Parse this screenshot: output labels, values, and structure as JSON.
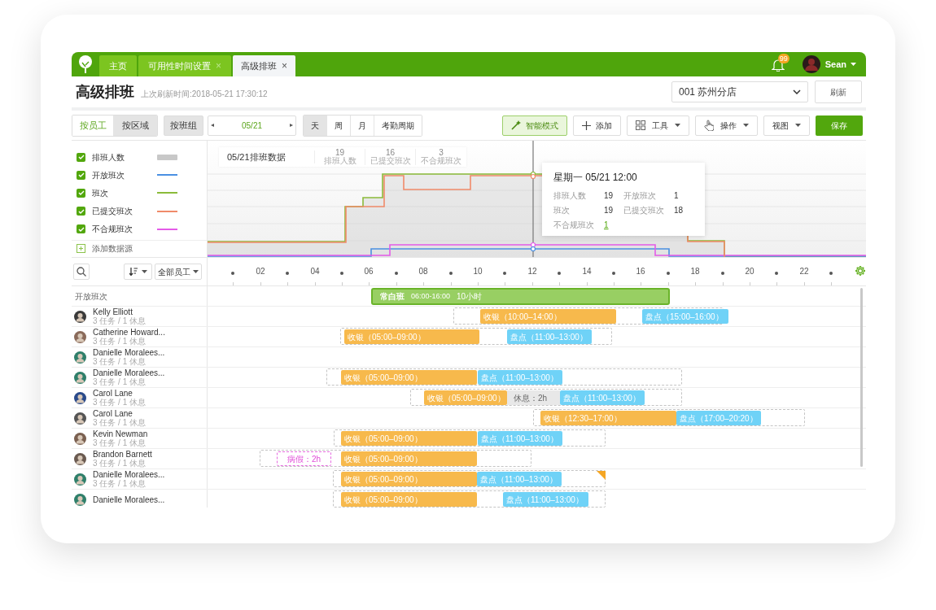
{
  "header": {
    "tabs": [
      {
        "label": "主页",
        "selected": false
      },
      {
        "label": "可用性时间设置",
        "close": "×",
        "selected": false
      },
      {
        "label": "高级排班",
        "close": "×",
        "selected": true
      }
    ],
    "notification_count": "99",
    "user": "Sean"
  },
  "page": {
    "title": "高级排班",
    "last_refresh": "上次刷新时间:2018-05-21 17:30:12",
    "store": "001 苏州分店",
    "refresh": "刷新"
  },
  "toolbar": {
    "group_by": [
      {
        "label": "按员工",
        "selected": true
      },
      {
        "label": "按区域",
        "selected": false
      }
    ],
    "group_button": "按班组",
    "prev": "◂",
    "date": "05/21",
    "next": "▸",
    "views": [
      {
        "label": "天",
        "selected": true
      },
      {
        "label": "周",
        "selected": false
      },
      {
        "label": "月",
        "selected": false
      },
      {
        "label": "考勤周期",
        "selected": false
      }
    ],
    "actions": [
      {
        "label": "智能模式",
        "kind": "smart"
      },
      {
        "label": "添加",
        "kind": "add"
      },
      {
        "label": "工具",
        "kind": "tools"
      },
      {
        "label": "操作",
        "kind": "operate"
      },
      {
        "label": "视图",
        "kind": "view"
      },
      {
        "label": "保存",
        "kind": "save"
      }
    ]
  },
  "legend": {
    "items": [
      {
        "label": "排班人数",
        "checked": true,
        "kind": "area",
        "color": "#c8c8c8"
      },
      {
        "label": "开放班次",
        "checked": true,
        "kind": "line",
        "color": "#4a90e2"
      },
      {
        "label": "班次",
        "checked": true,
        "kind": "line",
        "color": "#8bbb3a"
      },
      {
        "label": "已提交班次",
        "checked": true,
        "kind": "line",
        "color": "#f08a6a"
      },
      {
        "label": "不合规班次",
        "checked": true,
        "kind": "line",
        "color": "#e45be8"
      }
    ],
    "add_source": "添加数据源"
  },
  "summary": {
    "title": "05/21排班数据",
    "stats": [
      {
        "value": "19",
        "label": "排班人数"
      },
      {
        "value": "16",
        "label": "已提交班次"
      },
      {
        "value": "3",
        "label": "不合规班次"
      }
    ]
  },
  "tooltip": {
    "title": "星期一 05/21  12:00",
    "entries": [
      {
        "label": "排班人数",
        "value": "19",
        "link": false
      },
      {
        "label": "开放班次",
        "value": "1",
        "link": false
      },
      {
        "label": "班次",
        "value": "19",
        "link": false
      },
      {
        "label": "已提交班次",
        "value": "18",
        "link": false
      },
      {
        "label": "不合规班次",
        "value": "1",
        "link": true
      }
    ]
  },
  "filters": {
    "employee_filter": "全部员工"
  },
  "timeline": {
    "hours": [
      "02",
      "04",
      "06",
      "08",
      "10",
      "12",
      "14",
      "16",
      "18",
      "20",
      "22"
    ]
  },
  "open_shifts": {
    "label": "开放班次",
    "shifts": [
      {
        "name": "常白班",
        "time": "06:00-16:00",
        "duration": "10小时"
      }
    ]
  },
  "employees": [
    {
      "name": "Kelly Elliott",
      "summary": "3 任务 / 1 休息",
      "warning": false,
      "shifts": [
        {
          "kind": "cashier",
          "label": "收银（10:00–14:00）"
        },
        {
          "kind": "count",
          "label": "盘点（15:00–16:00）"
        }
      ]
    },
    {
      "name": "Catherine Howard...",
      "summary": "3 任务 / 1 休息",
      "warning": false,
      "shifts": [
        {
          "kind": "cashier",
          "label": "收银（05:00–09:00）"
        },
        {
          "kind": "count",
          "label": "盘点（11:00–13:00）"
        }
      ]
    },
    {
      "name": "Danielle Moralees...",
      "summary": "3 任务 / 1 休息",
      "warning": false
    },
    {
      "name": "Danielle Moralees...",
      "summary": "3 任务 / 1 休息",
      "warning": false,
      "shifts": [
        {
          "kind": "cashier",
          "label": "收银（05:00–09:00）"
        },
        {
          "kind": "count",
          "label": "盘点（11:00–13:00）"
        }
      ]
    },
    {
      "name": "Carol Lane",
      "summary": "3 任务 / 1 休息",
      "warning": false,
      "shifts": [
        {
          "kind": "cashier",
          "label": "收银（05:00–09:00）"
        },
        {
          "kind": "break",
          "label": "休息：2h"
        },
        {
          "kind": "count",
          "label": "盘点（11:00–13:00）"
        }
      ]
    },
    {
      "name": "Carol Lane",
      "summary": "3 任务 / 1 休息",
      "warning": false,
      "shifts": [
        {
          "kind": "cashier",
          "label": "收银（12:30–17:00）"
        },
        {
          "kind": "count",
          "label": "盘点（17:00–20:20）"
        }
      ]
    },
    {
      "name": "Kevin Newman",
      "summary": "3 任务 / 1 休息",
      "warning": false,
      "shifts": [
        {
          "kind": "cashier",
          "label": "收银（05:00–09:00）"
        },
        {
          "kind": "count",
          "label": "盘点（11:00–13:00）"
        }
      ]
    },
    {
      "name": "Brandon Barnett",
      "summary": "3 任务 / 1 休息",
      "warning": false,
      "shifts": [
        {
          "kind": "leave",
          "label": "病假：2h"
        },
        {
          "kind": "cashier",
          "label": "收银（05:00–09:00）"
        }
      ]
    },
    {
      "name": "Danielle Moralees...",
      "summary": "3 任务 / 1 休息",
      "warning": true,
      "shifts": [
        {
          "kind": "cashier",
          "label": "收银（05:00–09:00）"
        },
        {
          "kind": "count",
          "label": "盘点（11:00–13:00）"
        }
      ]
    },
    {
      "name": "Danielle Moralees...",
      "warning": false,
      "shifts": [
        {
          "kind": "cashier",
          "label": "收银（05:00–09:00）"
        },
        {
          "kind": "count",
          "label": "盘点（11:00–13:00）"
        }
      ]
    }
  ]
}
